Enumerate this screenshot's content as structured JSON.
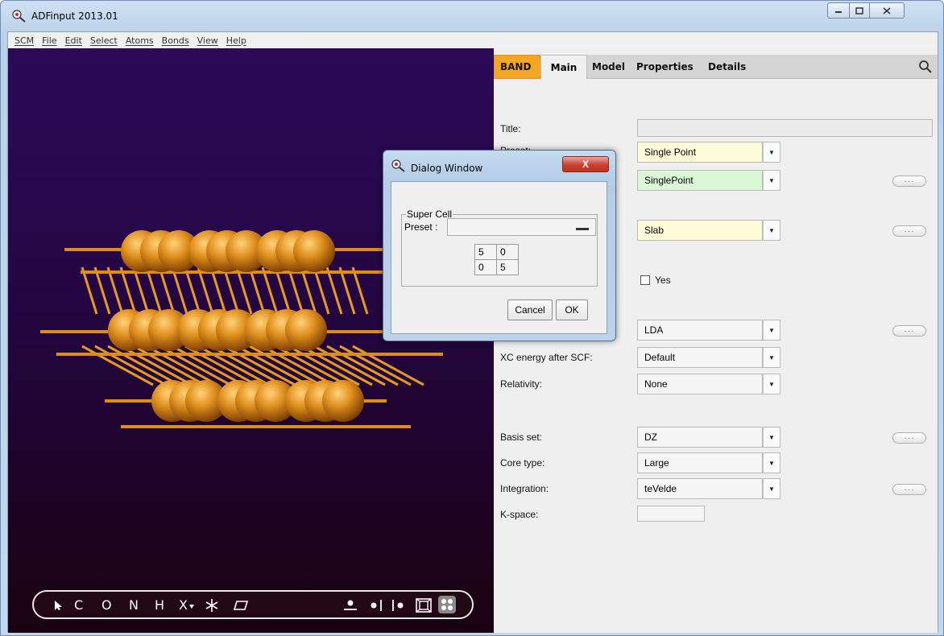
{
  "window": {
    "title": "ADFinput 2013.01"
  },
  "menu": [
    "SCM",
    "File",
    "Edit",
    "Select",
    "Atoms",
    "Bonds",
    "View",
    "Help"
  ],
  "toolbar": {
    "tools": [
      "C",
      "O",
      "N",
      "H",
      "X"
    ],
    "icons": [
      "select-arrow-icon",
      "snowflake-icon",
      "plane-icon",
      "dot-line-icon",
      "dot-bar-icon",
      "bar-dot-icon",
      "frame-icon",
      "dots-grid-icon"
    ]
  },
  "tabs": {
    "engine": "BAND",
    "main": "Main",
    "model": "Model",
    "properties": "Properties",
    "details": "Details"
  },
  "form": {
    "title_label": "Title:",
    "title_value": "",
    "preset_label": "Preset:",
    "preset_value": "Single Point",
    "task_value": "SinglePoint",
    "periodicity_value": "Slab",
    "yes_label": "Yes",
    "xc_value": "LDA",
    "xc_after_label": "XC energy after SCF:",
    "xc_after_value": "Default",
    "relativity_label": "Relativity:",
    "relativity_value": "None",
    "basis_label": "Basis set:",
    "basis_value": "DZ",
    "core_label": "Core type:",
    "core_value": "Large",
    "integration_label": "Integration:",
    "integration_value": "teVelde",
    "kspace_label": "K-space:",
    "kspace_value": ""
  },
  "dialog": {
    "title": "Dialog Window",
    "close": "X",
    "group": "Super Cell",
    "preset_label": "Preset :",
    "matrix": [
      "5",
      "0",
      "0",
      "5"
    ],
    "cancel": "Cancel",
    "ok": "OK"
  },
  "colors": {
    "band_tab": "#f5a623",
    "preset_bg": "#fdfbd8",
    "task_bg": "#dcf7d8",
    "atom": "#e0901e"
  }
}
